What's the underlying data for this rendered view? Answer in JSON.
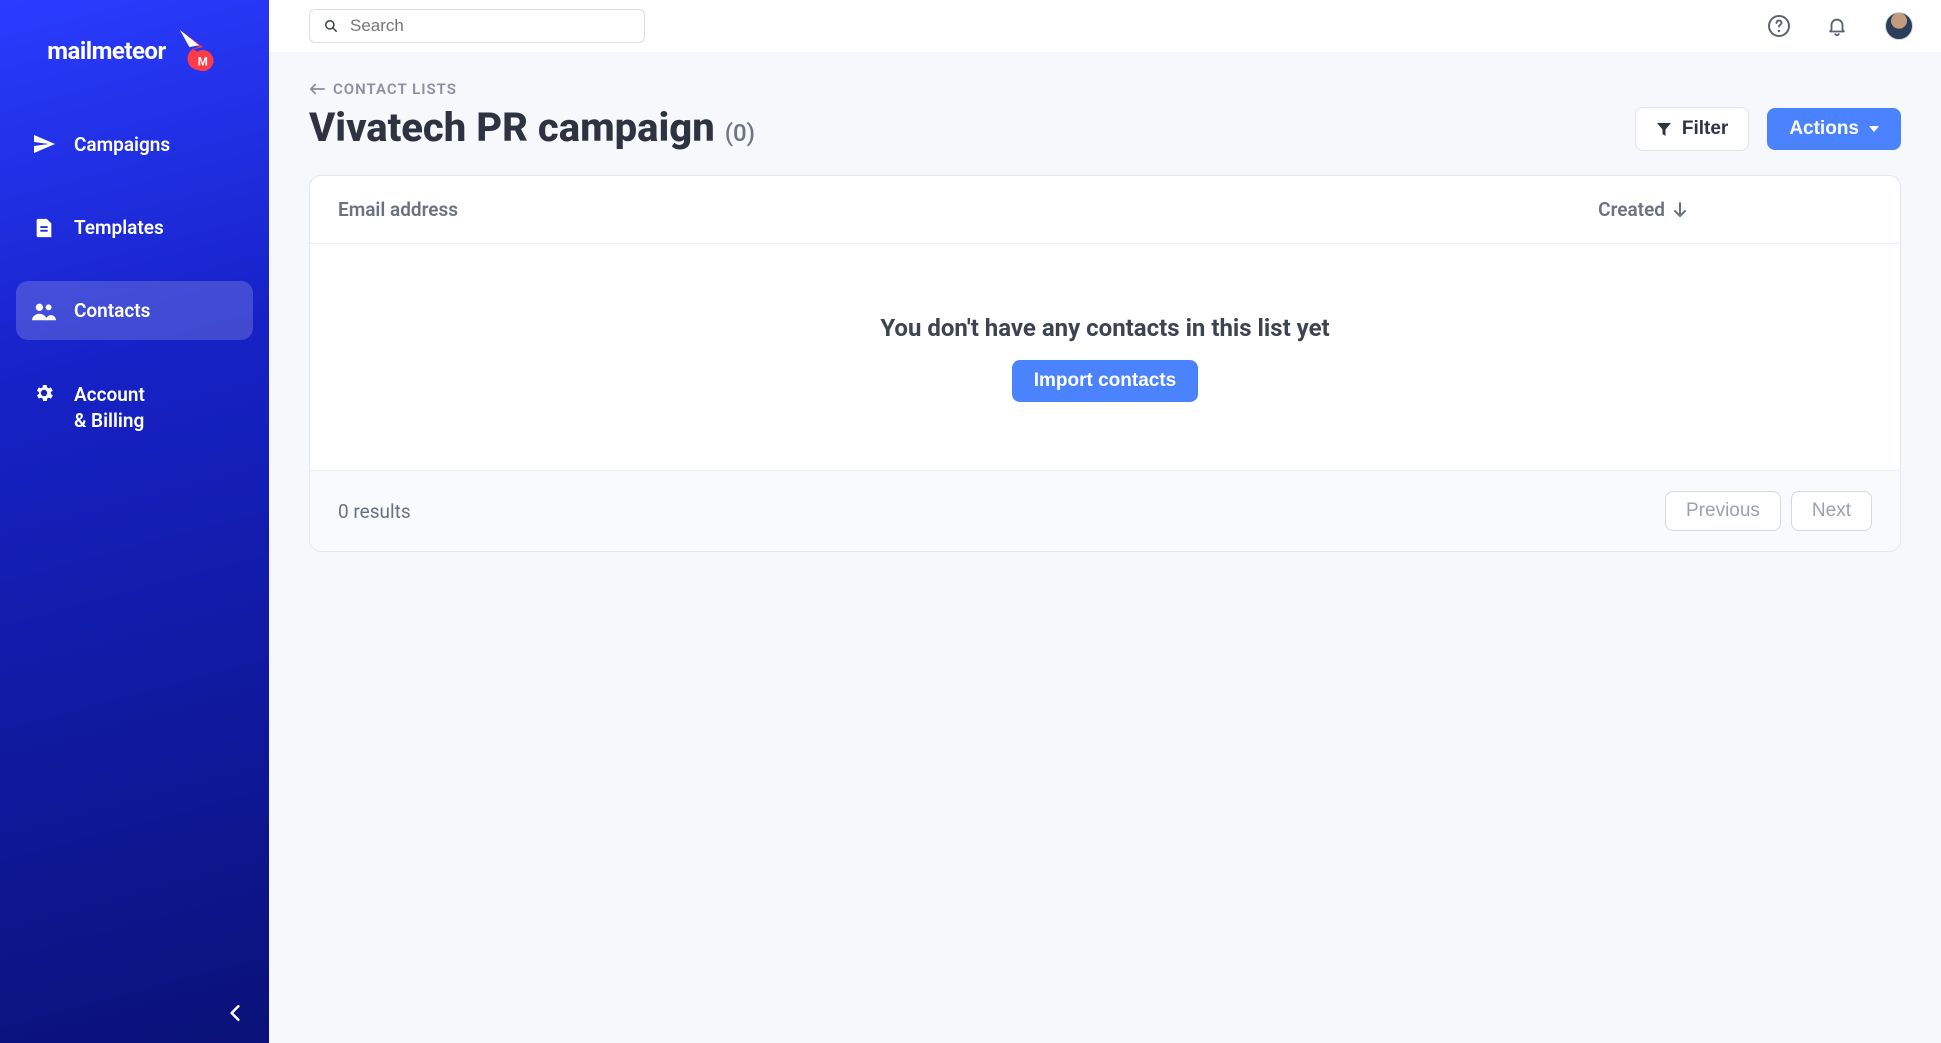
{
  "brand": {
    "name": "mailmeteor"
  },
  "sidebar": {
    "items": [
      {
        "label": "Campaigns"
      },
      {
        "label": "Templates"
      },
      {
        "label": "Contacts"
      },
      {
        "label": "Account\n& Billing"
      }
    ]
  },
  "topbar": {
    "search_placeholder": "Search"
  },
  "header": {
    "breadcrumb": "CONTACT LISTS",
    "title": "Vivatech PR campaign",
    "count": "(0)",
    "filter_label": "Filter",
    "actions_label": "Actions"
  },
  "table": {
    "col_email": "Email address",
    "col_created": "Created",
    "empty_title": "You don't have any contacts in this list yet",
    "import_label": "Import contacts",
    "results_text": "0 results",
    "prev_label": "Previous",
    "next_label": "Next"
  }
}
